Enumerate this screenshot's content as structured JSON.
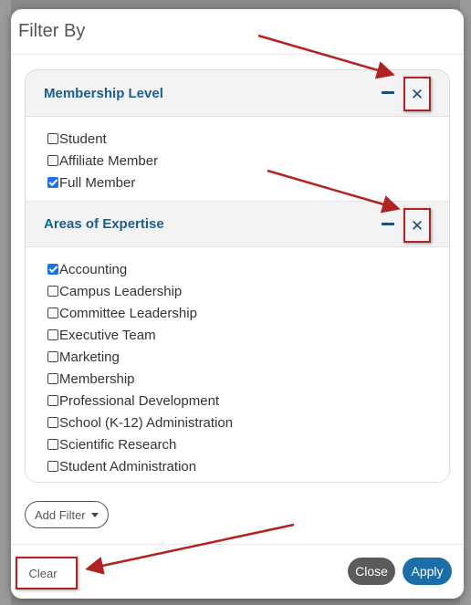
{
  "modal": {
    "title": "Filter By"
  },
  "sections": [
    {
      "title": "Membership Level",
      "options": [
        {
          "label": "Student",
          "checked": false
        },
        {
          "label": "Affiliate Member",
          "checked": false
        },
        {
          "label": "Full Member",
          "checked": true
        }
      ]
    },
    {
      "title": "Areas of Expertise",
      "options": [
        {
          "label": "Accounting",
          "checked": true
        },
        {
          "label": "Campus Leadership",
          "checked": false
        },
        {
          "label": "Committee Leadership",
          "checked": false
        },
        {
          "label": "Executive Team",
          "checked": false
        },
        {
          "label": "Marketing",
          "checked": false
        },
        {
          "label": "Membership",
          "checked": false
        },
        {
          "label": "Professional Development",
          "checked": false
        },
        {
          "label": "School (K-12) Administration",
          "checked": false
        },
        {
          "label": "Scientific Research",
          "checked": false
        },
        {
          "label": "Student Administration",
          "checked": false
        }
      ]
    }
  ],
  "add_filter": {
    "label": "Add Filter"
  },
  "footer": {
    "clear_label": "Clear",
    "close_label": "Close",
    "apply_label": "Apply"
  },
  "colors": {
    "accent": "#1b6fa8",
    "annotation": "#b22222",
    "close_button": "#5b5b5b",
    "checkbox_checked": "#1a73e8"
  }
}
